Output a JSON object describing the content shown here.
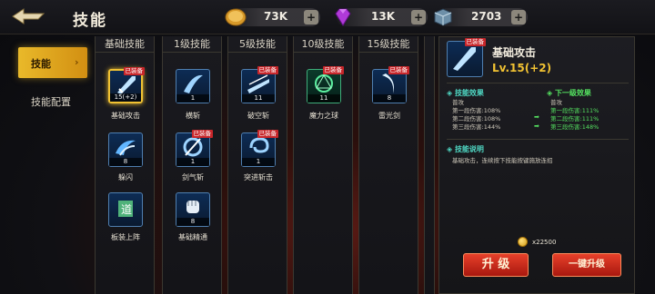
{
  "header": {
    "title": "技能",
    "resources": [
      {
        "name": "gold",
        "value": "73K",
        "icon": "gold-coin-icon"
      },
      {
        "name": "gems",
        "value": "13K",
        "icon": "purple-gem-icon"
      },
      {
        "name": "crystal",
        "value": "2703",
        "icon": "crystal-box-icon"
      }
    ],
    "plus_label": "+"
  },
  "sidebar": {
    "tabs": [
      {
        "label": "技能",
        "active": true
      },
      {
        "label": "技能配置",
        "active": false
      }
    ]
  },
  "columns": [
    {
      "header": "基础技能",
      "skills": [
        {
          "name": "基础攻击",
          "level": "15(+2)",
          "equipped": true,
          "selected": true
        },
        {
          "name": "躲闪",
          "level": "8",
          "equipped": false
        },
        {
          "name": "板装上阵",
          "level": "",
          "equipped": false
        }
      ]
    },
    {
      "header": "1级技能",
      "skills": [
        {
          "name": "横斩",
          "level": "1",
          "equipped": false
        },
        {
          "name": "剑气斩",
          "level": "1",
          "equipped": true
        },
        {
          "name": "基础精通",
          "level": "8",
          "equipped": false
        }
      ]
    },
    {
      "header": "5级技能",
      "skills": [
        {
          "name": "破空斩",
          "level": "11",
          "equipped": true
        },
        {
          "name": "突进斩击",
          "level": "1",
          "equipped": true
        }
      ]
    },
    {
      "header": "10级技能",
      "skills": [
        {
          "name": "魔力之球",
          "level": "11",
          "equipped": true
        }
      ]
    },
    {
      "header": "15级技能",
      "skills": [
        {
          "name": "雷光剑",
          "level": "8",
          "equipped": true
        }
      ]
    }
  ],
  "equipped_badge": "已装备",
  "detail": {
    "name": "基础攻击",
    "level": "Lv.15(+2)",
    "effect_title": "技能效果",
    "next_title": "下一级效果",
    "effect_lines": [
      "普攻",
      "第一段伤害:108%",
      "第二段伤害:108%",
      "第三段伤害:144%"
    ],
    "next_lines": [
      "普攻",
      "第一段伤害:111%",
      "第二段伤害:111%",
      "第三段伤害:148%"
    ],
    "desc_title": "技能说明",
    "desc": "基础攻击，连续按下技能按键施放连招",
    "cost": "x22500",
    "upgrade_label": "升 级",
    "max_upgrade_label": "一键升级"
  },
  "colors": {
    "accent": "#f1c232",
    "effect": "#4fd8c4",
    "next": "#54e060",
    "button": "#d52f1e"
  }
}
